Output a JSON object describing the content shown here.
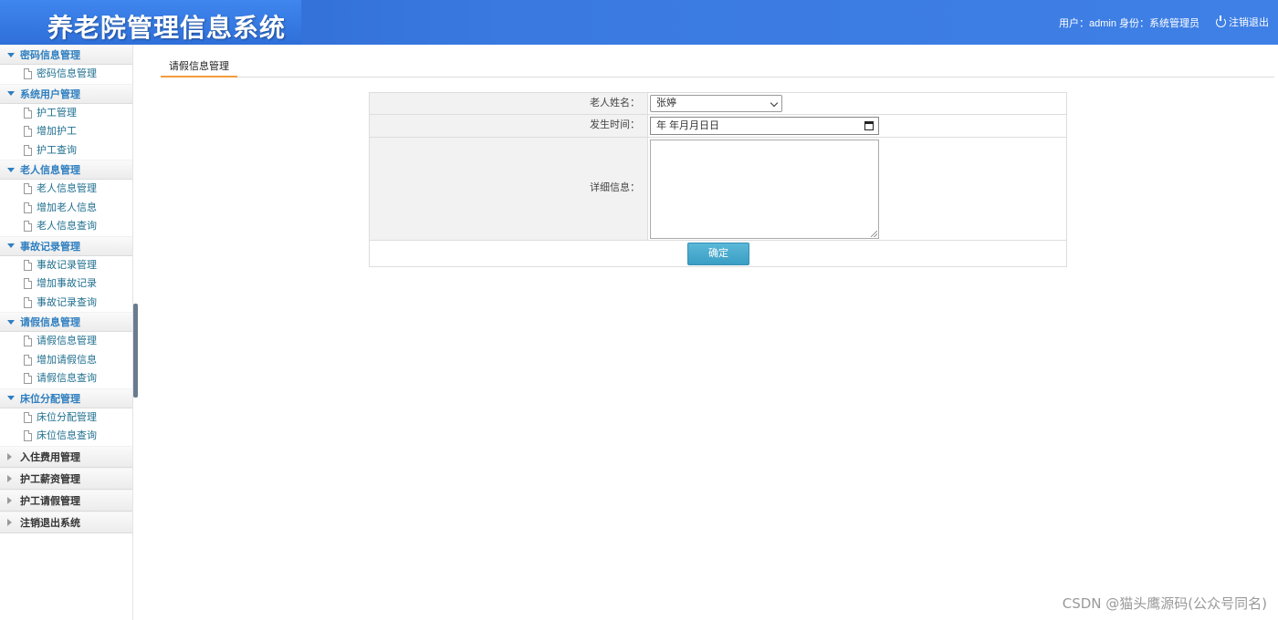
{
  "header": {
    "title": "养老院管理信息系统",
    "user_info": "用户：admin 身份：系统管理员",
    "logout_label": "注销退出"
  },
  "sidebar": {
    "groups": [
      {
        "label": "密码信息管理",
        "items": [
          "密码信息管理"
        ]
      },
      {
        "label": "系统用户管理",
        "items": [
          "护工管理",
          "增加护工",
          "护工查询"
        ]
      },
      {
        "label": "老人信息管理",
        "items": [
          "老人信息管理",
          "增加老人信息",
          "老人信息查询"
        ]
      },
      {
        "label": "事故记录管理",
        "items": [
          "事故记录管理",
          "增加事故记录",
          "事故记录查询"
        ]
      },
      {
        "label": "请假信息管理",
        "items": [
          "请假信息管理",
          "增加请假信息",
          "请假信息查询"
        ]
      },
      {
        "label": "床位分配管理",
        "items": [
          "床位分配管理",
          "床位信息查询"
        ]
      }
    ],
    "collapsed_groups": [
      "入住费用管理",
      "护工薪资管理",
      "护工请假管理",
      "注销退出系统"
    ]
  },
  "main": {
    "tab_label": "请假信息管理",
    "form": {
      "name_label": "老人姓名：",
      "name_value": "张婷",
      "time_label": "发生时间：",
      "time_placeholder": "年 年月月日日",
      "detail_label": "详细信息：",
      "detail_value": "",
      "submit_label": "确定"
    }
  },
  "watermark": "CSDN @猫头鹰源码(公众号同名)"
}
